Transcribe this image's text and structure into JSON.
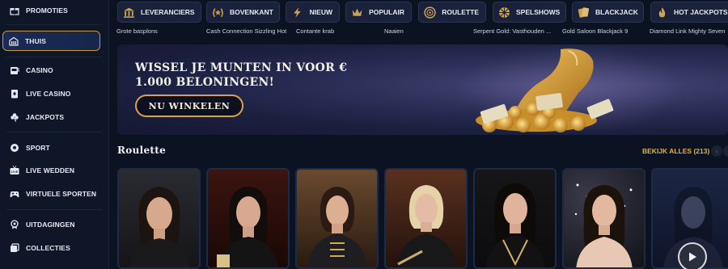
{
  "sidebar": {
    "items": [
      {
        "label": "PROMOTIES",
        "icon": "gift-icon"
      },
      {
        "label": "THUIS",
        "icon": "home-icon",
        "active": true
      },
      {
        "label": "CASINO",
        "icon": "slot-icon"
      },
      {
        "label": "LIVE CASINO",
        "icon": "cards-icon"
      },
      {
        "label": "JACKPOTS",
        "icon": "clover-icon"
      },
      {
        "label": "SPORT",
        "icon": "soccer-ball-icon"
      },
      {
        "label": "LIVE WEDDEN",
        "icon": "live-tv-icon"
      },
      {
        "label": "VIRTUELE SPORTEN",
        "icon": "gamepad-icon"
      },
      {
        "label": "UITDAGINGEN",
        "icon": "medal-icon"
      },
      {
        "label": "COLLECTIES",
        "icon": "collection-icon"
      }
    ]
  },
  "categories": [
    {
      "label": "LEVERANCIERS",
      "icon": "building-icon",
      "sub": "Grote basplons"
    },
    {
      "label": "BOVENKANT",
      "icon": "laurel-icon",
      "sub": "Cash Connection Sizzling Hot"
    },
    {
      "label": "NIEUW",
      "icon": "lightning-icon",
      "sub": "Contante krab"
    },
    {
      "label": "POPULAIR",
      "icon": "crown-icon",
      "sub": "Naaien"
    },
    {
      "label": "ROULETTE",
      "icon": "roulette-icon",
      "sub": ""
    },
    {
      "label": "SPELSHOWS",
      "icon": "wheel-icon",
      "sub": "Serpent Gold: Vasthouden ..."
    },
    {
      "label": "BLACKJACK",
      "icon": "cards-icon",
      "sub": "Gold Saloon Blackjack 9"
    },
    {
      "label": "HOT JACKPOTS",
      "icon": "flame-icon",
      "sub": "Diamond Link Mighty Seven"
    }
  ],
  "banner": {
    "title": "WISSEL JE MUNTEN IN VOOR € 1.000 BELONINGEN!",
    "button": "NU WINKELEN"
  },
  "section": {
    "title": "Roulette",
    "see_all": "BEKIJK ALLES (213)"
  },
  "colors": {
    "accent_gold": "#d6a445",
    "background": "#0b1221",
    "sidebar": "#0e1628",
    "active_bg": "#1a2a55"
  }
}
